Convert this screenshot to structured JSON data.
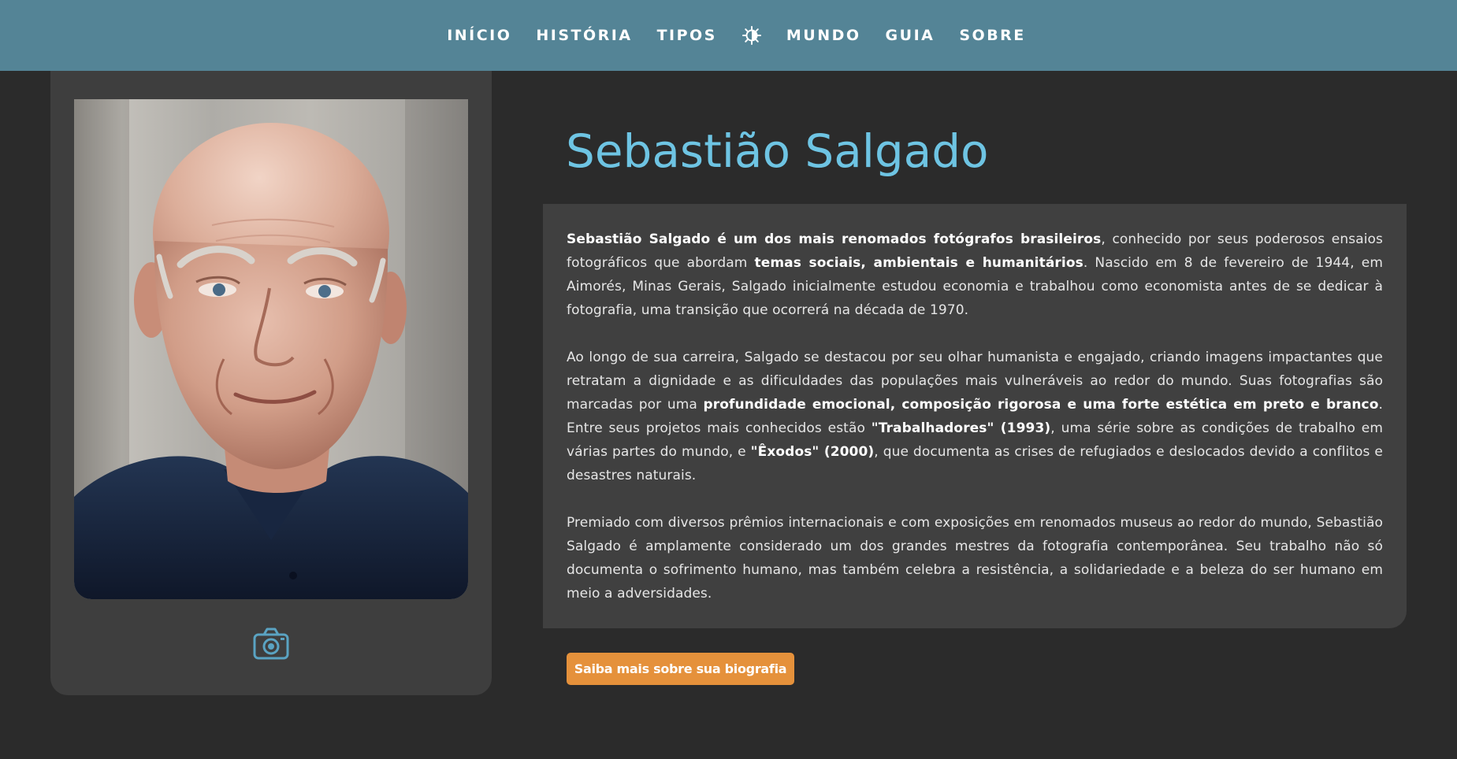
{
  "nav": {
    "items": [
      {
        "label": "INÍCIO"
      },
      {
        "label": "HISTÓRIA"
      },
      {
        "label": "TIPOS"
      },
      {
        "label": "MUNDO"
      },
      {
        "label": "GUIA"
      },
      {
        "label": "SOBRE"
      }
    ],
    "theme_toggle_icon": "sun-moon-icon"
  },
  "profile": {
    "photo_icon": "camera-icon",
    "name": "Sebastião Salgado"
  },
  "bio": {
    "p1": {
      "b1": "Sebastião Salgado é um dos mais renomados fotógrafos brasileiros",
      "t1": ", conhecido por seus poderosos ensaios fotográficos que abordam ",
      "b2": "temas sociais, ambientais e humanitários",
      "t2": ". Nascido em 8 de fevereiro de 1944, em Aimorés, Minas Gerais, Salgado inicialmente estudou economia e trabalhou como economista antes de se dedicar à fotografia, uma transição que ocorrerá na década de 1970."
    },
    "p2": {
      "t1": "Ao longo de sua carreira, Salgado se destacou por seu olhar humanista e engajado, criando imagens impactantes que retratam a dignidade e as dificuldades das populações mais vulneráveis ao redor do mundo. Suas fotografias são marcadas por uma ",
      "b1": "profundidade emocional, composição rigorosa e uma forte estética em preto e branco",
      "t2": ". Entre seus projetos mais conhecidos estão ",
      "b2": "\"Trabalhadores\" (1993)",
      "t3": ", uma série sobre as condições de trabalho em várias partes do mundo, e ",
      "b3": "\"Êxodos\" (2000)",
      "t4": ", que documenta as crises de refugiados e deslocados devido a conflitos e desastres naturais."
    },
    "p3": {
      "t1": "Premiado com diversos prêmios internacionais e com exposições em renomados museus ao redor do mundo, Sebastião Salgado é amplamente considerado um dos grandes mestres da fotografia contemporânea. Seu trabalho não só documenta o sofrimento humano, mas também celebra a resistência, a solidariedade e a beleza do ser humano em meio a adversidades."
    }
  },
  "cta": {
    "label": "Saiba mais sobre sua biografia",
    "color": "#e5913b"
  },
  "colors": {
    "nav_bg": "#548496",
    "accent_heading": "#6ec4e3",
    "page_bg": "#2b2b2b",
    "card_bg": "#3e3e3e"
  }
}
